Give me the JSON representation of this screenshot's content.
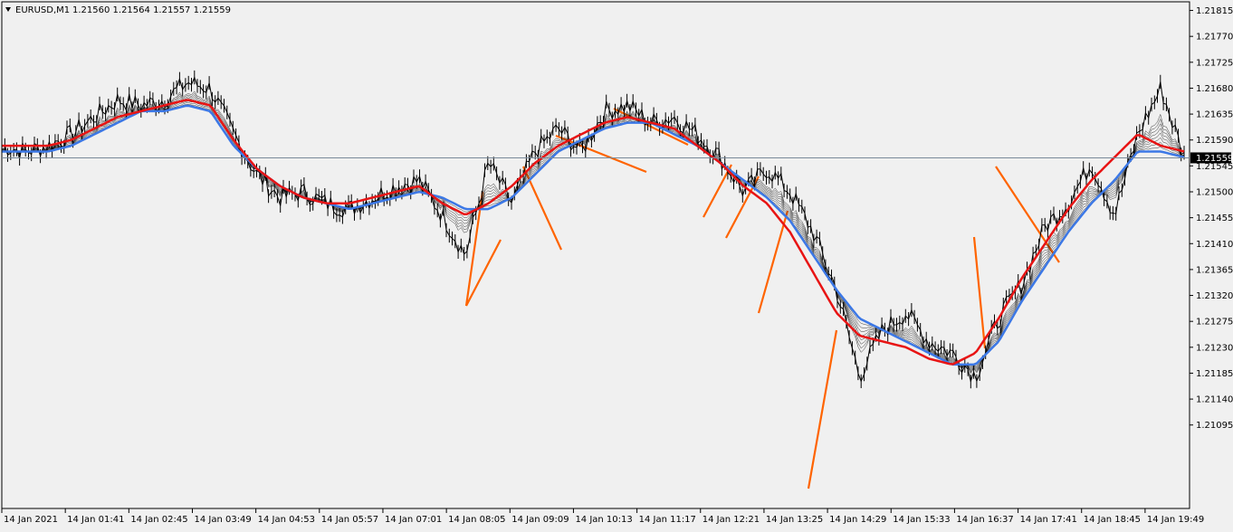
{
  "header": {
    "symbol": "EURUSD,M1",
    "ohlc": "1.21560 1.21564 1.21557 1.21559"
  },
  "current_price_label": "1.21559",
  "chart_data": {
    "type": "line",
    "title": "EURUSD,M1",
    "xlabel": "",
    "ylabel": "",
    "ylim": [
      1.2095,
      1.2183
    ],
    "y_ticks": [
      "1.21815",
      "1.21770",
      "1.21725",
      "1.21680",
      "1.21635",
      "1.21590",
      "1.21545",
      "1.21500",
      "1.21455",
      "1.21410",
      "1.21365",
      "1.21320",
      "1.21275",
      "1.21230",
      "1.21185",
      "1.21140",
      "1.21095"
    ],
    "x_ticks": [
      "14 Jan 2021",
      "14 Jan 01:41",
      "14 Jan 02:45",
      "14 Jan 03:49",
      "14 Jan 04:53",
      "14 Jan 05:57",
      "14 Jan 07:01",
      "14 Jan 08:05",
      "14 Jan 09:09",
      "14 Jan 10:13",
      "14 Jan 11:17",
      "14 Jan 12:21",
      "14 Jan 13:25",
      "14 Jan 14:29",
      "14 Jan 15:33",
      "14 Jan 16:37",
      "14 Jan 17:41",
      "14 Jan 18:45",
      "14 Jan 19:49"
    ],
    "current_price": 1.21559,
    "grid": false,
    "colors": {
      "background": "#f0f0f0",
      "price": "#000000",
      "ma_slow": "#e81414",
      "ma_fast": "#3c78e6",
      "ma_ribbon": "#000000",
      "trendlines": "#ff6400",
      "current_price_line": "#7a8a9a"
    },
    "series": [
      {
        "values": [
          1.2158,
          1.2157,
          1.2158,
          1.216,
          1.2163,
          1.2166,
          1.2165,
          1.2166,
          1.2169,
          1.2168,
          1.216,
          1.2153,
          1.2149,
          1.215,
          1.2148,
          1.2147,
          1.2149,
          1.2151,
          1.2152,
          1.2146,
          1.2139,
          1.2155,
          1.2148,
          1.2157,
          1.2161,
          1.2157,
          1.2164,
          1.2165,
          1.2162,
          1.2163,
          1.216,
          1.2156,
          1.215,
          1.2154,
          1.215,
          1.2143,
          1.2133,
          1.2118,
          1.2126,
          1.2129,
          1.2124,
          1.2122,
          1.2118,
          1.2128,
          1.2134,
          1.2144,
          1.2148,
          1.2155,
          1.2146,
          1.216,
          1.2168,
          1.2156
        ]
      },
      {
        "values": [
          1.2158,
          1.2158,
          1.2158,
          1.2159,
          1.2161,
          1.2163,
          1.2164,
          1.2165,
          1.2166,
          1.2165,
          1.2159,
          1.2154,
          1.2151,
          1.2149,
          1.2148,
          1.2148,
          1.2149,
          1.215,
          1.2151,
          1.2148,
          1.2146,
          1.2148,
          1.2151,
          1.2155,
          1.2158,
          1.216,
          1.2162,
          1.2163,
          1.2162,
          1.2161,
          1.2158,
          1.2155,
          1.2151,
          1.2148,
          1.2143,
          1.2136,
          1.2129,
          1.2125,
          1.2124,
          1.2123,
          1.2121,
          1.212,
          1.2122,
          1.2128,
          1.2135,
          1.2141,
          1.2147,
          1.2152,
          1.2156,
          1.216,
          1.2158,
          1.2157
        ]
      },
      {
        "values": [
          1.2157,
          1.2157,
          1.2157,
          1.2158,
          1.216,
          1.2162,
          1.2164,
          1.2164,
          1.2165,
          1.2164,
          1.2158,
          1.2154,
          1.2151,
          1.2149,
          1.2148,
          1.2147,
          1.2148,
          1.2149,
          1.215,
          1.2149,
          1.2147,
          1.2147,
          1.2149,
          1.2153,
          1.2157,
          1.2159,
          1.2161,
          1.2162,
          1.2162,
          1.216,
          1.2158,
          1.2155,
          1.2152,
          1.2149,
          1.2145,
          1.2139,
          1.2133,
          1.2128,
          1.2126,
          1.2124,
          1.2122,
          1.212,
          1.212,
          1.2124,
          1.2131,
          1.2137,
          1.2143,
          1.2148,
          1.2152,
          1.2157,
          1.2157,
          1.2156
        ]
      }
    ]
  }
}
